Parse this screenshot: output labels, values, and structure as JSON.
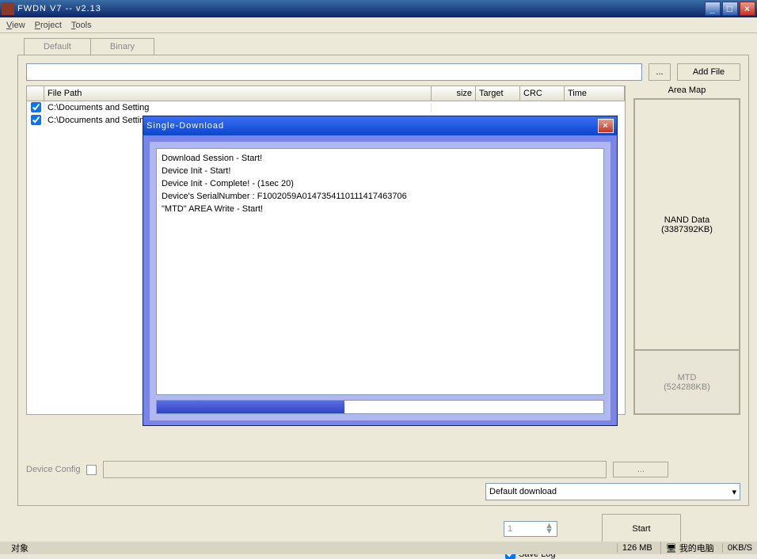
{
  "window": {
    "title": "FWDN V7 -- v2.13"
  },
  "menu": {
    "view": "View",
    "project": "Project",
    "tools": "Tools"
  },
  "tabs": {
    "default": "Default",
    "binary": "Binary"
  },
  "toolbar": {
    "browse": "...",
    "add_file": "Add File"
  },
  "table": {
    "headers": {
      "file_path": "File Path",
      "size": "size",
      "target": "Target",
      "crc": "CRC",
      "time": "Time"
    },
    "rows": [
      {
        "checked": true,
        "path": "C:\\Documents and Setting"
      },
      {
        "checked": true,
        "path": "C:\\Documents and Setting"
      }
    ]
  },
  "area_map": {
    "title": "Area Map",
    "nand_label": "NAND Data",
    "nand_size": "(3387392KB)",
    "mtd_label": "MTD",
    "mtd_size": "(524288KB)"
  },
  "bottom": {
    "device_config": "Device Config",
    "dots": "...",
    "download_mode": "Default download"
  },
  "run": {
    "count": "1",
    "save_log": "Save Log",
    "start": "Start"
  },
  "statusbar": {
    "size": "126 MB",
    "computer": "我的电脑",
    "speed": "0KB/S"
  },
  "modal": {
    "title": "Single-Download",
    "log": [
      "Download Session - Start!",
      "Device Init - Start!",
      "Device Init - Complete! - (1sec 20)",
      "Device's SerialNumber : F1002059A0147354110111417463706",
      "\"MTD\" AREA Write - Start!"
    ]
  }
}
